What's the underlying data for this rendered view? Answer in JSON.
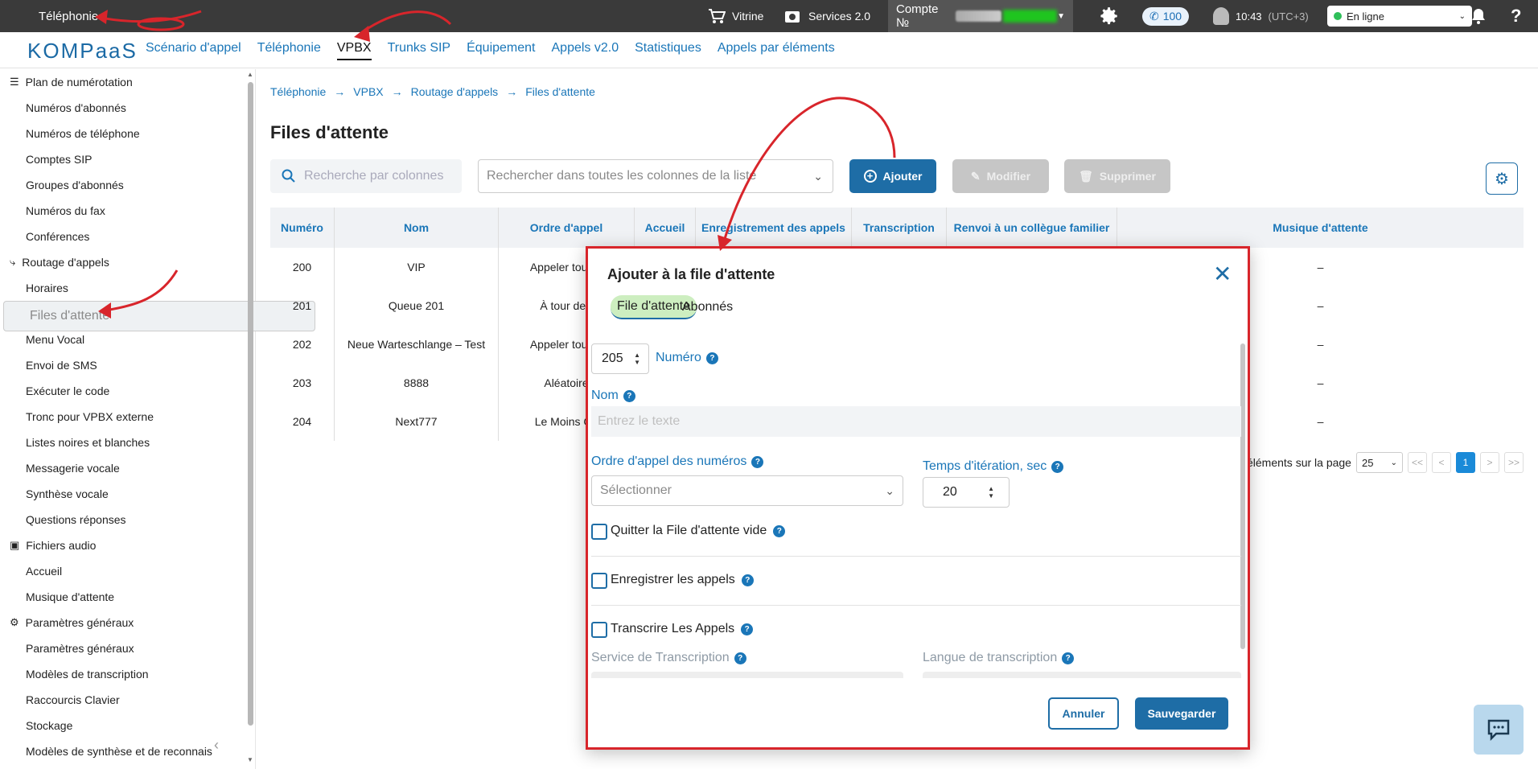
{
  "topbar": {
    "section": "Téléphonie",
    "vitrine": "Vitrine",
    "services": "Services 2.0",
    "account_label": "Compte №",
    "calls_count": "100",
    "time": "10:43",
    "timezone": "(UTC+3)",
    "status": "En ligne"
  },
  "logo": "KOMPaaS",
  "nav": [
    {
      "label": "Scénario d'appel"
    },
    {
      "label": "Téléphonie"
    },
    {
      "label": "VPBX",
      "active": true
    },
    {
      "label": "Trunks SIP"
    },
    {
      "label": "Équipement"
    },
    {
      "label": "Appels v2.0"
    },
    {
      "label": "Statistiques"
    },
    {
      "label": "Appels par éléments"
    }
  ],
  "sidebar": {
    "g1": "Plan de numérotation",
    "g1_items": [
      "Numéros d'abonnés",
      "Numéros de téléphone",
      "Comptes SIP",
      "Groupes d'abonnés",
      "Numéros du fax",
      "Conférences"
    ],
    "g2": "Routage d'appels",
    "g2_items": [
      "Horaires",
      "Files d'attente",
      "Menu Vocal",
      "Envoi de SMS",
      "Exécuter le code",
      "Tronc pour VPBX externe",
      "Listes noires et blanches",
      "Messagerie vocale",
      "Synthèse vocale",
      "Questions réponses"
    ],
    "g3": "Fichiers audio",
    "g3_items": [
      "Accueil",
      "Musique d'attente"
    ],
    "g4": "Paramètres généraux",
    "g4_items": [
      "Paramètres généraux",
      "Modèles de transcription",
      "Raccourcis Clavier",
      "Stockage",
      "Modèles de synthèse et de reconnais"
    ]
  },
  "breadcrumb": [
    "Téléphonie",
    "VPBX",
    "Routage d'appels",
    "Files d'attente"
  ],
  "page_title": "Files d'attente",
  "toolbar": {
    "search_placeholder": "Recherche par colonnes",
    "search_all_placeholder": "Rechercher dans toutes les colonnes de la liste",
    "add": "Ajouter",
    "modify": "Modifier",
    "delete": "Supprimer"
  },
  "table": {
    "headers": [
      "Numéro",
      "Nom",
      "Ordre d'appel",
      "Accueil",
      "Enregistrement des appels",
      "Transcription",
      "Renvoi à un collègue familier",
      "Musique d'attente"
    ],
    "rows": [
      [
        "200",
        "VIP",
        "Appeler tout le",
        "",
        "",
        "",
        "",
        "–"
      ],
      [
        "201",
        "Queue 201",
        "À tour de r",
        "",
        "",
        "",
        "",
        "–"
      ],
      [
        "202",
        "Neue Warteschlange – Test",
        "Appeler tout le",
        "",
        "",
        "",
        "",
        "–"
      ],
      [
        "203",
        "8888",
        "Aléatoire",
        "",
        "",
        "",
        "",
        "–"
      ],
      [
        "204",
        "Next777",
        "Le Moins Ch",
        "",
        "",
        "",
        "",
        "–"
      ]
    ]
  },
  "pager": {
    "label": "éléments sur la page",
    "per_page": "25",
    "first": "<<",
    "prev": "<",
    "current": "1",
    "next": ">",
    "last": ">>"
  },
  "modal": {
    "title": "Ajouter à la file d'attente",
    "tab_queue": "File d'attente",
    "tab_subscribers": "Abonnés",
    "number_value": "205",
    "number_label": "Numéro",
    "name_label": "Nom",
    "name_placeholder": "Entrez le texte",
    "call_order_label": "Ordre d'appel des numéros",
    "call_order_placeholder": "Sélectionner",
    "iteration_label": "Temps d'itération, sec",
    "iteration_value": "20",
    "quit_empty": "Quitter la File d'attente vide",
    "record_calls": "Enregistrer les appels",
    "transcribe_calls": "Transcrire Les Appels",
    "transcription_service": "Service de Transcription",
    "transcription_language": "Langue de transcription",
    "cancel": "Annuler",
    "save": "Sauvegarder"
  }
}
